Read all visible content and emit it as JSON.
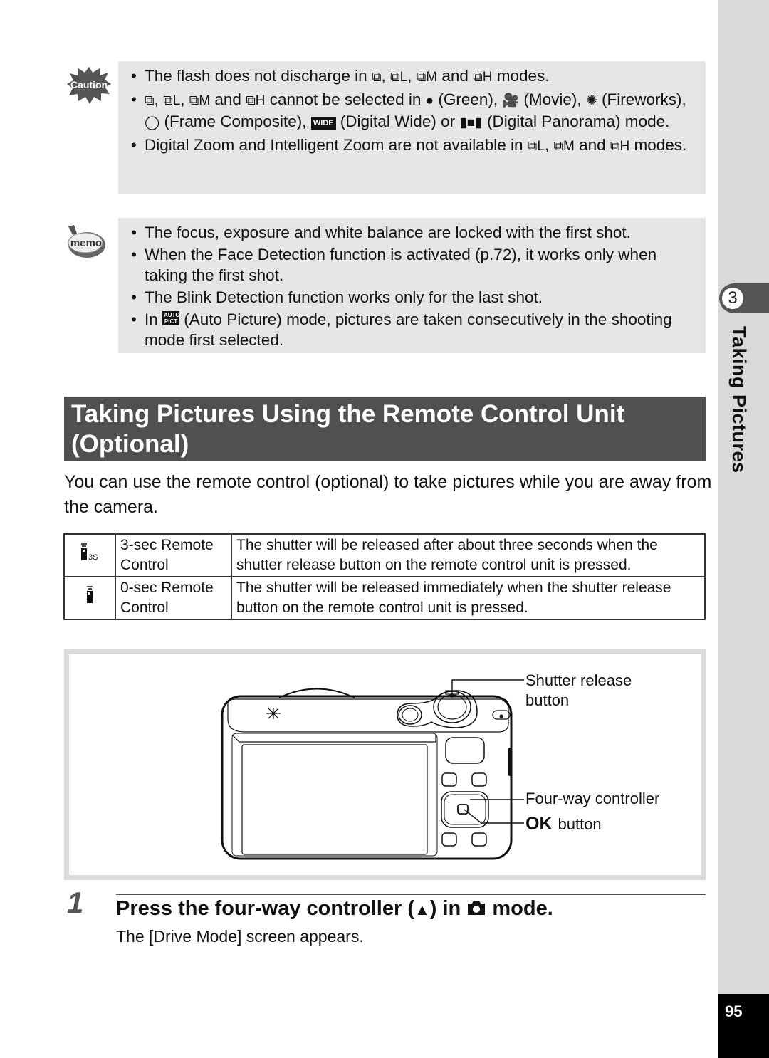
{
  "caution": {
    "icon_label": "Caution",
    "items": [
      {
        "parts": [
          "The flash does not discharge in ",
          "⧉",
          ", ",
          "⧉L",
          ", ",
          "⧉M",
          " and ",
          "⧉H",
          " modes."
        ]
      },
      {
        "parts": [
          "⧉",
          ", ",
          "⧉L",
          ", ",
          "⧉M",
          " and ",
          "⧉H",
          " cannot be selected in ",
          "●",
          " (Green), ",
          "🎥",
          " (Movie), ",
          "✺",
          " (Fireworks), ",
          "◯",
          " (Frame Composite), ",
          "WIDE",
          " (Digital Wide) or ",
          "▮■▮",
          " (Digital Panorama) mode."
        ]
      },
      {
        "parts": [
          "Digital Zoom and Intelligent Zoom are not available in ",
          "⧉L",
          ", ",
          "⧉M",
          " and ",
          "⧉H",
          " modes."
        ]
      }
    ]
  },
  "memo": {
    "icon_label": "memo",
    "items": [
      {
        "text": "The focus, exposure and white balance are locked with the first shot."
      },
      {
        "text": "When the Face Detection function is activated (p.72), it works only when taking the first shot."
      },
      {
        "text": "The Blink Detection function works only for the last shot."
      },
      {
        "pre": "In ",
        "badge": "AUTO PICT",
        "post": " (Auto Picture) mode, pictures are taken consecutively in the shooting mode first selected."
      }
    ]
  },
  "section": {
    "heading": "Taking Pictures Using the Remote Control Unit (Optional)",
    "intro": "You can use the remote control (optional) to take pictures while you are away from the camera."
  },
  "modes_table": {
    "rows": [
      {
        "icon": "remote-3s-icon",
        "icon_suffix": "3S",
        "name": "3-sec Remote Control",
        "description": "The shutter will be released after about three seconds when the shutter release button on the remote control unit is pressed."
      },
      {
        "icon": "remote-0s-icon",
        "icon_suffix": "",
        "name": "0-sec Remote Control",
        "description": "The shutter will be released immediately when the shutter release button on the remote control unit is pressed."
      }
    ]
  },
  "figure": {
    "callouts": {
      "shutter": "Shutter release button",
      "four_way": "Four-way controller",
      "ok_key": "OK",
      "ok_rest": "button"
    }
  },
  "step": {
    "number": "1",
    "title_pre": "Press the four-way controller (",
    "title_arrow": "▲",
    "title_mid": ") in ",
    "title_post": " mode.",
    "description": "The [Drive Mode] screen appears."
  },
  "sidebar": {
    "chapter_number": "3",
    "chapter_title": "Taking Pictures",
    "page_number": "95"
  }
}
